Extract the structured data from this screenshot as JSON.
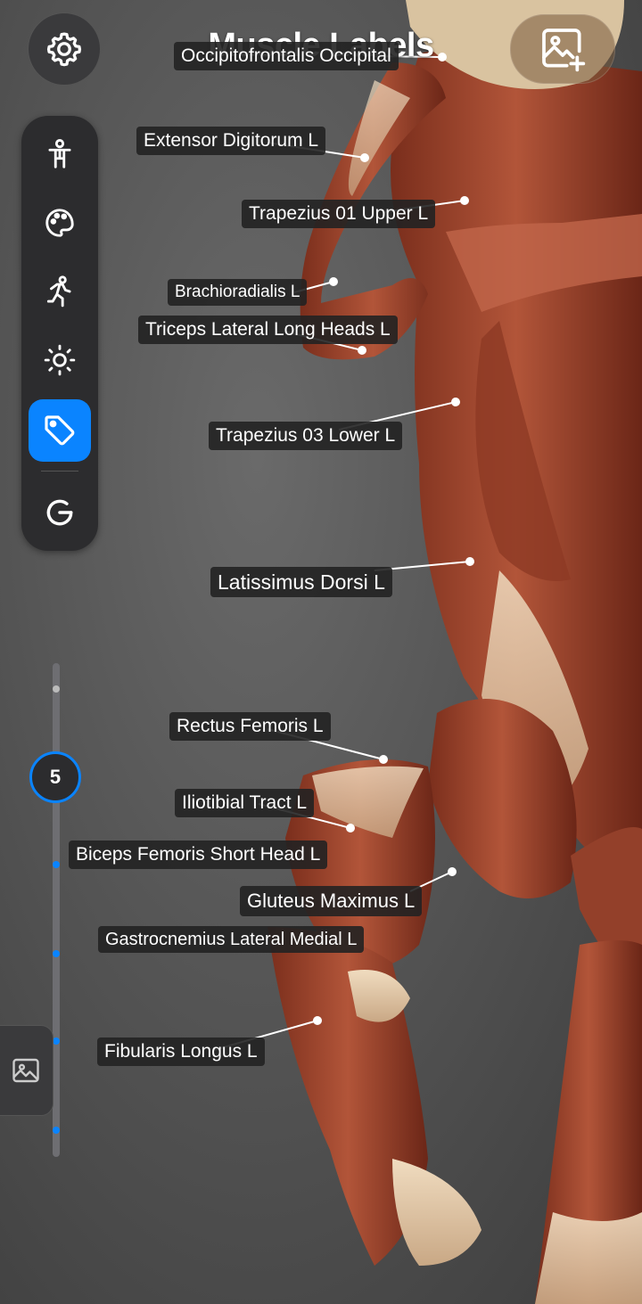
{
  "header": {
    "title": "Muscle Labels"
  },
  "icons": {
    "settings": "gear-icon",
    "add_photo": "add-photo-icon",
    "tools": [
      "body-icon",
      "palette-icon",
      "pose-icon",
      "brightness-icon",
      "tag-icon",
      "reset-icon"
    ],
    "gallery": "image-icon"
  },
  "colors": {
    "accent": "#0a84ff",
    "label_bg": "#222222",
    "muscle": "#a8472f"
  },
  "toolbar": {
    "active_tool": "labels"
  },
  "slider": {
    "value": "5"
  },
  "labels": [
    "Occipitofrontalis Occipital",
    "Extensor Digitorum  L",
    "Trapezius 01 Upper  L",
    "Brachioradialis  L",
    "Triceps Lateral Long Heads  L",
    "Trapezius 03 Lower  L",
    "Latissimus Dorsi  L",
    "Rectus Femoris  L",
    "Iliotibial Tract  L",
    "Biceps Femoris Short Head  L",
    "Gluteus Maximus  L",
    "Gastrocnemius Lateral Medial  L",
    "Fibularis Longus  L"
  ]
}
